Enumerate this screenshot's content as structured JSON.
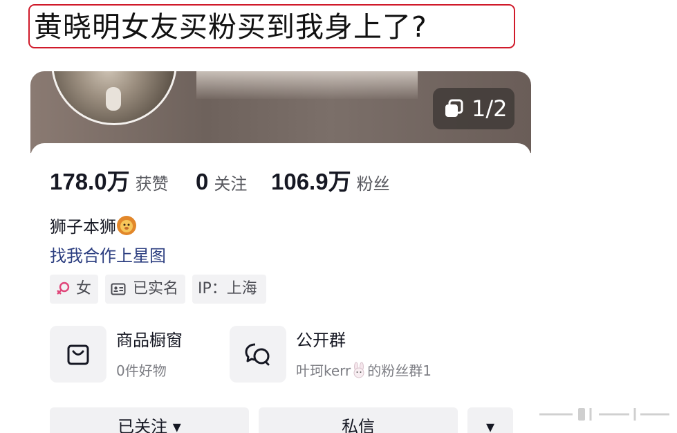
{
  "headline": "黄晓明女友买粉买到我身上了?",
  "cover": {
    "page_indicator": "1/2"
  },
  "stats": [
    {
      "value": "178.0万",
      "label": "获赞"
    },
    {
      "value": "0",
      "label": "关注"
    },
    {
      "value": "106.9万",
      "label": "粉丝"
    }
  ],
  "bio": {
    "name_line": "狮子本狮",
    "link": "找我合作上星图"
  },
  "tags": [
    {
      "icon": "female-icon",
      "text": "女"
    },
    {
      "icon": "id-card-icon",
      "text": "已实名"
    },
    {
      "icon": null,
      "text": "IP：上海"
    }
  ],
  "tiles": [
    {
      "icon": "shopping-bag-icon",
      "title": "商品橱窗",
      "subtitle": "0件好物"
    },
    {
      "icon": "chat-bubbles-icon",
      "title": "公开群",
      "subtitle_prefix": "叶珂kerr",
      "subtitle_suffix": "的粉丝群1"
    }
  ],
  "actions": {
    "follow_label": "已关注 ▾",
    "message_label": "私信",
    "more_label": "▾"
  },
  "colors": {
    "headline_border": "#d01a2a",
    "link": "#2c3e80",
    "female": "#e0467a"
  }
}
